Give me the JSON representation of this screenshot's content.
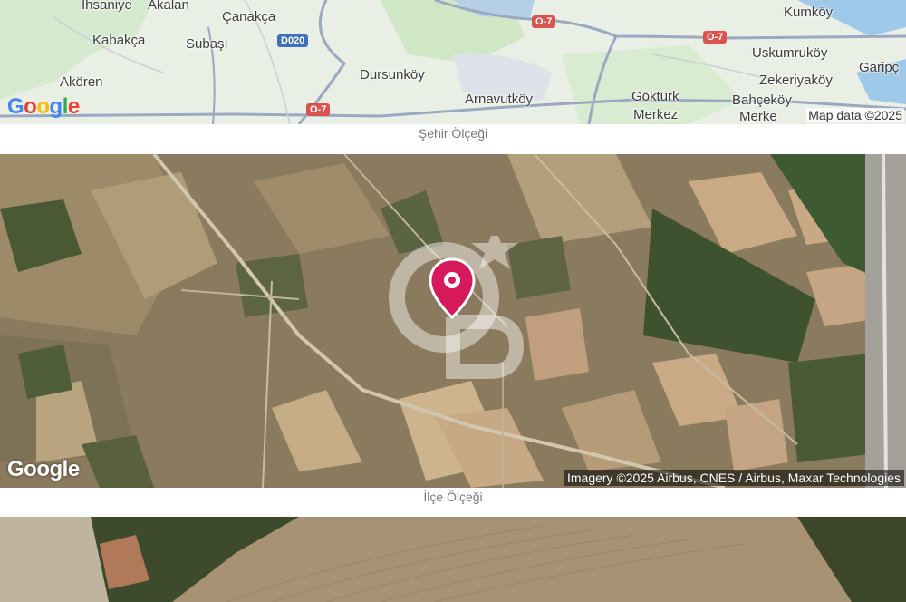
{
  "city_map": {
    "places": [
      "İhsaniye",
      "Akalan",
      "Çanakça",
      "Kabakça",
      "Subaşı",
      "Akören",
      "Dursunköy",
      "Arnavutköy",
      "Göktürk",
      "Merkez",
      "Kumköy",
      "Uskumruköy",
      "Garipç",
      "Zekeriyaköy",
      "Bahçeköy",
      "Merke"
    ],
    "roads": [
      "D020",
      "O-7",
      "O-7",
      "O-7"
    ],
    "logo": "Google",
    "attribution": "Map data ©2025",
    "caption": "Şehir Ölçeği",
    "colors": {
      "land": "#e9efe4",
      "water": "#9fc9e8",
      "road": "#9aa9c2",
      "park": "#cfe7c4"
    }
  },
  "district_map": {
    "logo": "Google",
    "attribution": "Imagery ©2025 Airbus, CNES / Airbus, Maxar Technologies",
    "caption": "İlçe Ölçeği",
    "marker": {
      "icon": "location-pin-icon",
      "color": "#d6195a"
    },
    "watermark": "CB"
  },
  "street_map": {
    "colors": {
      "field": "#a89274",
      "trees": "#3d4a2c"
    }
  }
}
